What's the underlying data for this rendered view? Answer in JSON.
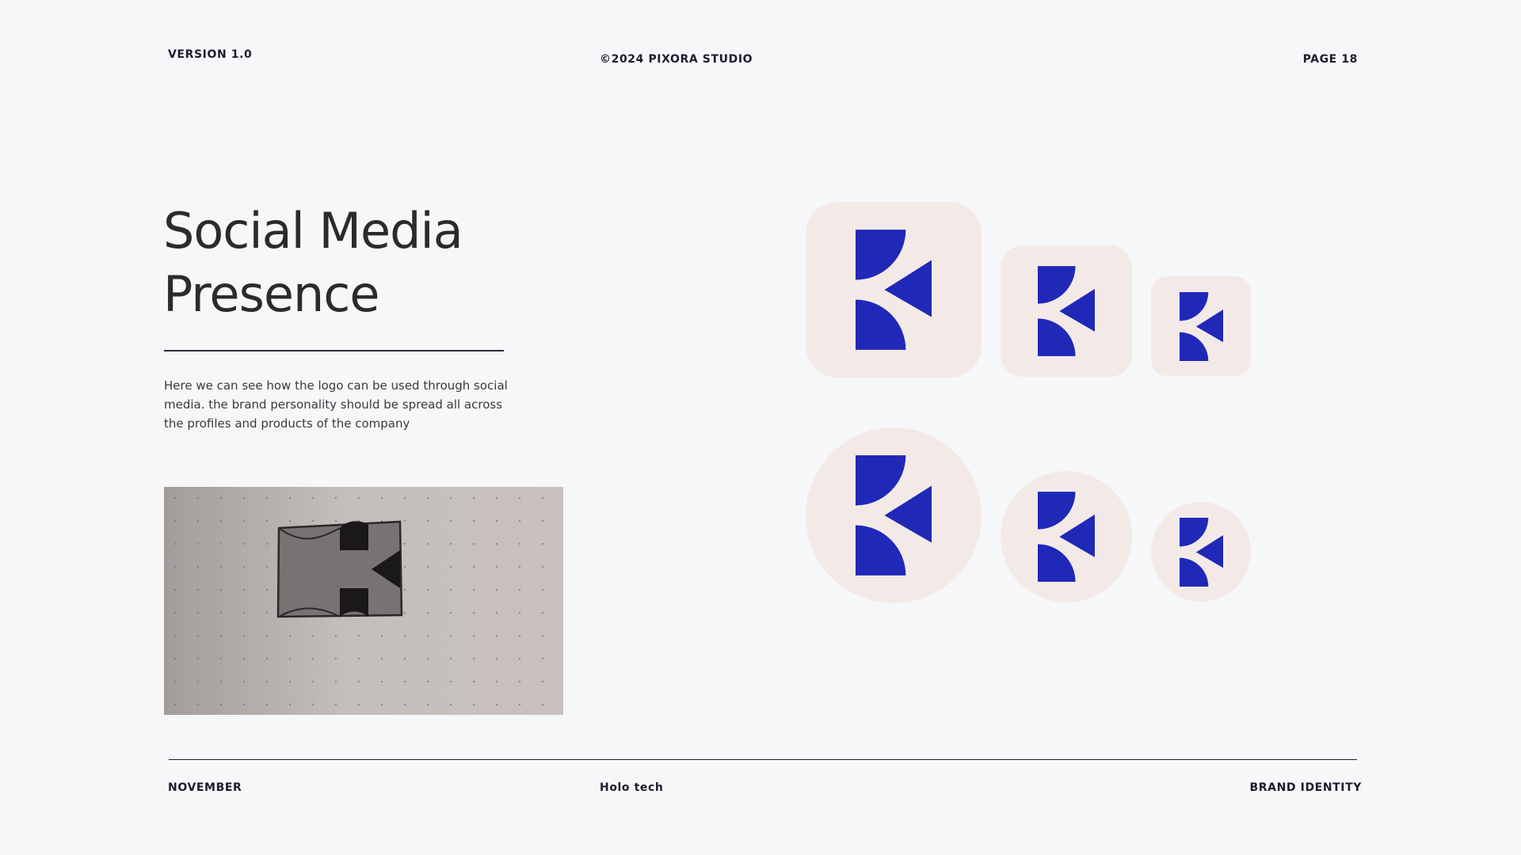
{
  "header": {
    "version": "VERSION 1.0",
    "copyright": "©2024 PIXORA STUDIO",
    "page": "PAGE 18"
  },
  "content": {
    "title_line1": "Social Media",
    "title_line2": "Presence",
    "description": "Here we can see how the logo can be used through social media. the brand personality should be spread all across the profiles and products of the company"
  },
  "footer": {
    "month": "NOVEMBER",
    "company": "Holo tech",
    "section": "BRAND IDENTITY"
  },
  "icons": {
    "logo": "k-mark-icon",
    "sketch": "logo-sketch-photo"
  },
  "colors": {
    "background": "#f6f7f9",
    "brand_blue": "#2028b8",
    "tile_background": "#f3eae7",
    "text_dark": "#2b2b2e"
  }
}
